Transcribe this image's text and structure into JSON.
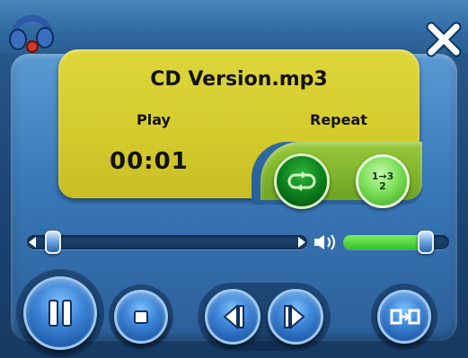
{
  "player": {
    "file_name": "CD Version.mp3",
    "status": "Play",
    "mode_label": "Repeat",
    "time": "00:01",
    "shuffle_label_top": "1",
    "shuffle_label_arrow": "→",
    "shuffle_label_3": "3",
    "shuffle_label_bottom": "2"
  },
  "seek": {
    "position_fraction": 0.02
  },
  "volume": {
    "level_fraction": 0.78
  },
  "icons": {
    "logo": "headphones-icon",
    "close": "close-icon",
    "repeat": "repeat-icon",
    "shuffle": "shuffle-order-icon",
    "speaker": "speaker-icon",
    "pause": "pause-icon",
    "stop": "stop-icon",
    "prev": "previous-track-icon",
    "next": "next-track-icon",
    "mini": "mini-mode-icon"
  },
  "colors": {
    "lcd": "#d4ca2c",
    "accent_green": "#35c02a",
    "button_blue": "#3f86d8"
  }
}
